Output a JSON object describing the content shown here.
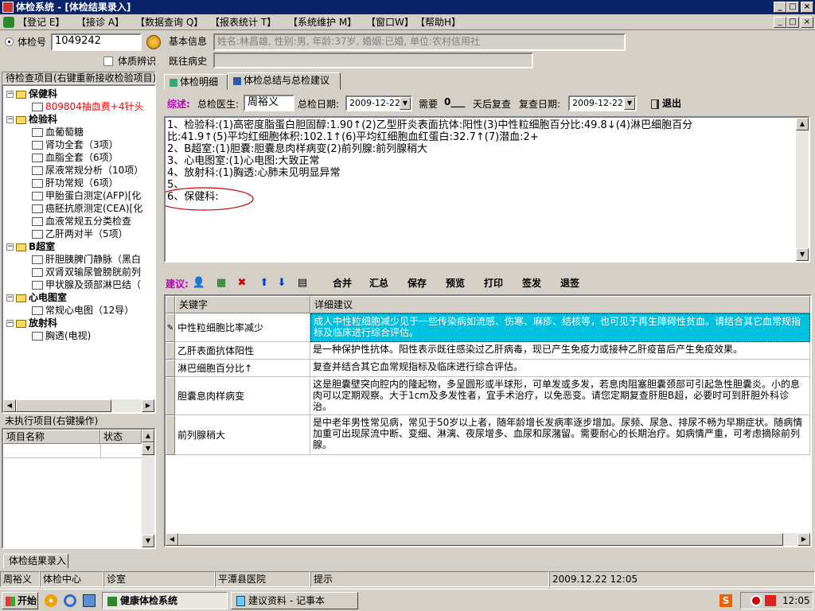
{
  "window": {
    "title": "体检系统 - [体检结果录入]",
    "title_controls": [
      "_",
      "□",
      "×"
    ],
    "menu_controls": [
      "_",
      "□",
      "×"
    ]
  },
  "menu": [
    "【登记 E】",
    "【接诊 A】",
    "【数据查询 Q】",
    "【报表统计 T】",
    "【系统维护 M】",
    "【窗口W】",
    "【帮助H】"
  ],
  "left": {
    "exam_no_label": "体检号",
    "exam_no_value": "1049242",
    "constitution_label": "体质辨识",
    "pending_header": "待检查项目(右键重新接收检验项目)",
    "tree": [
      {
        "level": 0,
        "type": "folder",
        "label": "保健科"
      },
      {
        "level": 1,
        "type": "doc",
        "label": "809804抽血费+4针头",
        "color": "#ff0000"
      },
      {
        "level": 0,
        "type": "folder",
        "label": "检验科"
      },
      {
        "level": 1,
        "type": "doc",
        "label": "血葡萄糖"
      },
      {
        "level": 1,
        "type": "doc",
        "label": "肾功全套（3项）"
      },
      {
        "level": 1,
        "type": "doc",
        "label": "血脂全套（6项）"
      },
      {
        "level": 1,
        "type": "doc",
        "label": "尿液常规分析（10项）"
      },
      {
        "level": 1,
        "type": "doc",
        "label": "肝功常规（6项）"
      },
      {
        "level": 1,
        "type": "doc",
        "label": "甲胎蛋白测定(AFP)[化"
      },
      {
        "level": 1,
        "type": "doc",
        "label": "癌胚抗原测定(CEA)[化"
      },
      {
        "level": 1,
        "type": "doc",
        "label": "血液常规五分类检查"
      },
      {
        "level": 1,
        "type": "doc",
        "label": "乙肝两对半（5项）"
      },
      {
        "level": 0,
        "type": "folder",
        "label": "B超室"
      },
      {
        "level": 1,
        "type": "doc",
        "label": "肝胆胰脾门静脉（黑白"
      },
      {
        "level": 1,
        "type": "doc",
        "label": "双肾双输尿管膀胱前列"
      },
      {
        "level": 1,
        "type": "doc",
        "label": "甲状腺及颈部淋巴结（"
      },
      {
        "level": 0,
        "type": "folder",
        "label": "心电图室"
      },
      {
        "level": 1,
        "type": "doc",
        "label": "常规心电图（12导）"
      },
      {
        "level": 0,
        "type": "folder",
        "label": "放射科"
      },
      {
        "level": 1,
        "type": "doc",
        "label": "胸透(电视)"
      }
    ],
    "unexecuted_header": "未执行项目(右键操作)",
    "unexecuted_cols": [
      "项目名称",
      "状态"
    ]
  },
  "info": {
    "basic_label": "基本信息",
    "basic_value": "姓名:林昌雄, 性别:男, 年龄:37岁, 婚姻:已婚, 单位:农村信用社",
    "history_label": "既往病史",
    "history_value": ""
  },
  "tabs": [
    "体检明细",
    "体检总结与总检建议"
  ],
  "summary": {
    "label": "综述:",
    "doctor_label": "总检医生:",
    "doctor_value": "周裕义",
    "date_label": "总检日期:",
    "date_value": "2009-12-22",
    "need_label": "需要",
    "need_value": "0___",
    "days_label": "天后复查",
    "recheck_label": "复查日期:",
    "recheck_value": "2009-12-22",
    "exit_label": "退出",
    "lines": [
      "1、检验科:(1)高密度脂蛋白胆固醇:1.90↑(2)乙型肝炎表面抗体:阳性(3)中性粒细胞百分比:49.8↓(4)淋巴细胞百分",
      "比:41.9↑(5)平均红细胞体积:102.1↑(6)平均红细胞血红蛋白:32.7↑(7)潜血:2+",
      "2、B超室:(1)胆囊:胆囊息肉样病变(2)前列腺:前列腺稍大",
      "3、心电图室:(1)心电图:大致正常",
      "4、放射科:(1)胸透:心肺未见明显异常",
      "5、",
      "6、保健科:"
    ]
  },
  "advice": {
    "label": "建议:",
    "buttons": [
      "合并",
      "汇总",
      "保存",
      "预览",
      "打印",
      "签发",
      "退签"
    ],
    "col_keyword": "关键字",
    "col_detail": "详细建议",
    "rows": [
      {
        "keyword": "中性粒细胞比率减少",
        "detail": "成人中性粒细胞减少见于一些传染病如流感、伤寒、麻疹、结核等，也可见于再生障碍性贫血。请结合其它血常规指标及临床进行综合评估。"
      },
      {
        "keyword": "乙肝表面抗体阳性",
        "detail": "是一种保护性抗体。阳性表示既往感染过乙肝病毒，现已产生免疫力或接种乙肝疫苗后产生免疫效果。"
      },
      {
        "keyword": "淋巴细胞百分比↑",
        "detail": "复查并结合其它血常规指标及临床进行综合评估。"
      },
      {
        "keyword": "胆囊息肉样病变",
        "detail": "这是胆囊壁突向腔内的隆起物，多呈圆形或半球形，可单发或多发，若息肉阻塞胆囊颈部可引起急性胆囊炎。小的息肉可以定期观察。大于1cm及多发性者，宜手术治疗，以免恶变。请您定期复查肝胆B超，必要时可到肝胆外科诊治。"
      },
      {
        "keyword": "前列腺稍大",
        "detail": "是中老年男性常见病，常见于50岁以上者，随年龄增长发病率逐步增加。尿频、尿急、排尿不畅为早期症状。随病情加重可出现尿流中断、变细、淋漓、夜尿增多、血尿和尿潴留。需要耐心的长期治疗。如病情严重，可考虑摘除前列腺。"
      }
    ]
  },
  "bottom_tab": "体检结果录入",
  "status": [
    "周裕义",
    "体检中心",
    "诊室",
    "平潭县医院",
    "提示",
    "2009.12.22 12:05"
  ],
  "taskbar": {
    "start": "开始",
    "tasks": [
      "健康体检系统",
      "建议资料 - 记事本"
    ],
    "clock": "12:05"
  },
  "colors": {
    "title_bg": "#0a246a",
    "selection": "#00c0e0",
    "highlight_text": "#0000ff",
    "ellipse": "#d00000"
  }
}
